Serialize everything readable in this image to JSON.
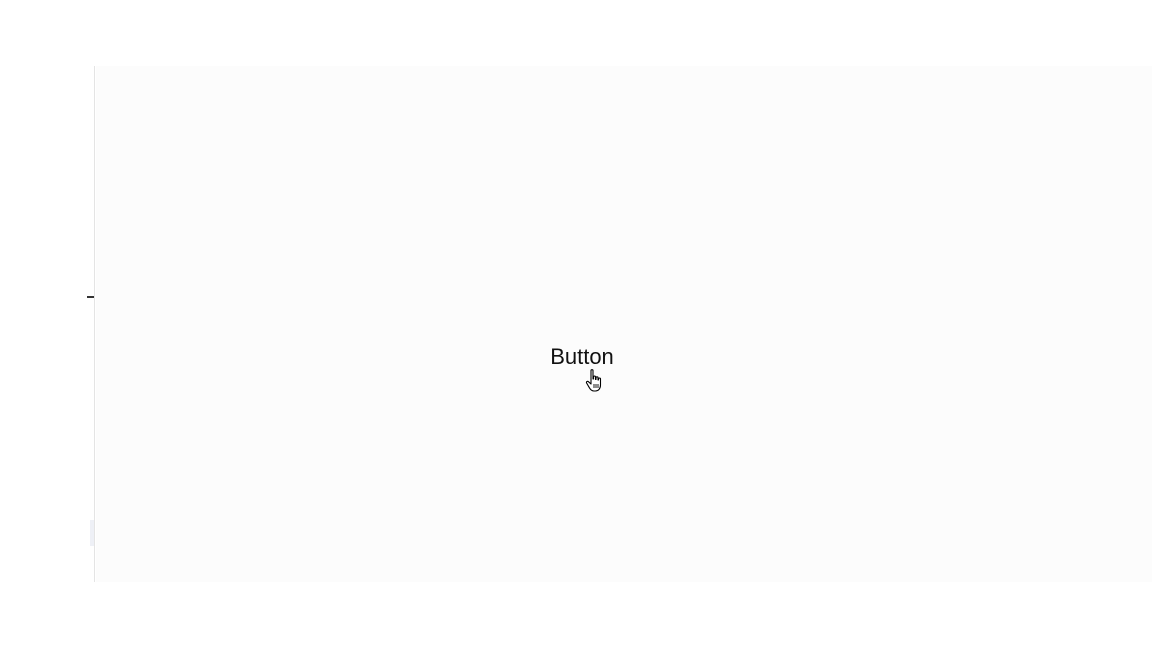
{
  "demo": {
    "button_label": "Button"
  },
  "cursor": {
    "icon": "hand-pointer-icon"
  },
  "colors": {
    "background": "#ffffff",
    "panel": "#fcfcfc",
    "rule": "#e4e4e4",
    "text": "#111111"
  }
}
